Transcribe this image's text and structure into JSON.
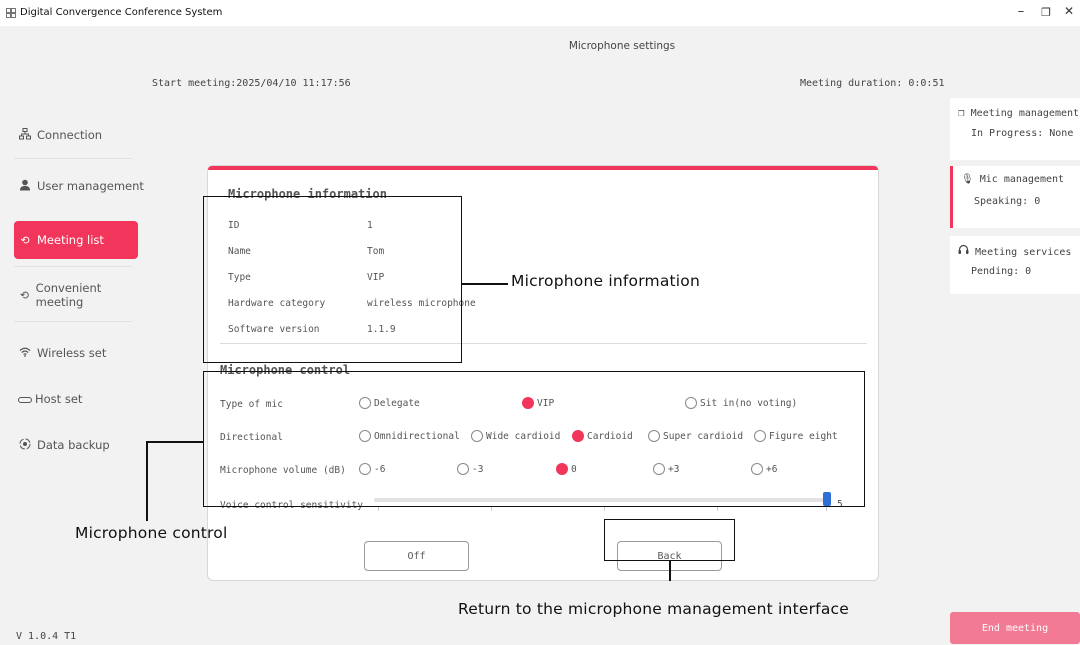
{
  "app": {
    "title": "Digital Convergence Conference System"
  },
  "window": {
    "minimize": "–",
    "maximize": "❐",
    "close": "✕"
  },
  "sidebar": {
    "items": [
      {
        "label": "Connection",
        "icon": "network-icon"
      },
      {
        "label": "User management",
        "icon": "user-icon"
      },
      {
        "label": "Meeting list",
        "icon": "meeting-icon"
      },
      {
        "label": "Convenient meeting",
        "icon": "meeting-icon"
      },
      {
        "label": "Wireless set",
        "icon": "wifi-icon"
      },
      {
        "label": "Host set",
        "icon": "host-icon"
      },
      {
        "label": "Data backup",
        "icon": "backup-icon"
      }
    ],
    "active": "Meeting list",
    "version": "V 1.0.4 T1"
  },
  "header": {
    "title": "Microphone settings",
    "start_meeting": "Start meeting:2025/04/10 11:17:56",
    "duration": "Meeting duration: 0:0:51"
  },
  "right_panel": {
    "cards": [
      {
        "title": "Meeting management",
        "status": "In Progress: None",
        "icon": "meeting-management-icon"
      },
      {
        "title": "Mic management",
        "status": "Speaking: 0",
        "icon": "mic-icon"
      },
      {
        "title": "Meeting services",
        "status": "Pending: 0",
        "icon": "headset-icon"
      }
    ],
    "end_button": "End meeting"
  },
  "dialog": {
    "info_title": "Microphone information",
    "info": [
      {
        "label": "ID",
        "value": "1"
      },
      {
        "label": "Name",
        "value": "Tom"
      },
      {
        "label": "Type",
        "value": "VIP"
      },
      {
        "label": "Hardware category",
        "value": "wireless microphone"
      },
      {
        "label": "Software version",
        "value": "1.1.9"
      }
    ],
    "control_title": "Microphone control",
    "type_label": "Type of mic",
    "type_options": [
      "Delegate",
      "VIP",
      "Sit in(no voting)"
    ],
    "type_selected": "VIP",
    "direction_label": "Directional",
    "direction_options": [
      "Omnidirectional",
      "Wide cardioid",
      "Cardioid",
      "Super cardioid",
      "Figure eight"
    ],
    "direction_selected": "Cardioid",
    "volume_label": "Microphone volume (dB)",
    "volume_options": [
      "-6",
      "-3",
      "0",
      "+3",
      "+6"
    ],
    "volume_selected": "0",
    "sensitivity_label": "Voice control sensitivity",
    "sensitivity_value": "5",
    "off_button": "Off",
    "back_button": "Back"
  },
  "annotations": {
    "info": "Microphone information",
    "control": "Microphone control",
    "back": "Return to the microphone management interface"
  },
  "colors": {
    "accent": "#f2355a",
    "end_button": "#f37a94",
    "slider": "#2f6fd6"
  }
}
